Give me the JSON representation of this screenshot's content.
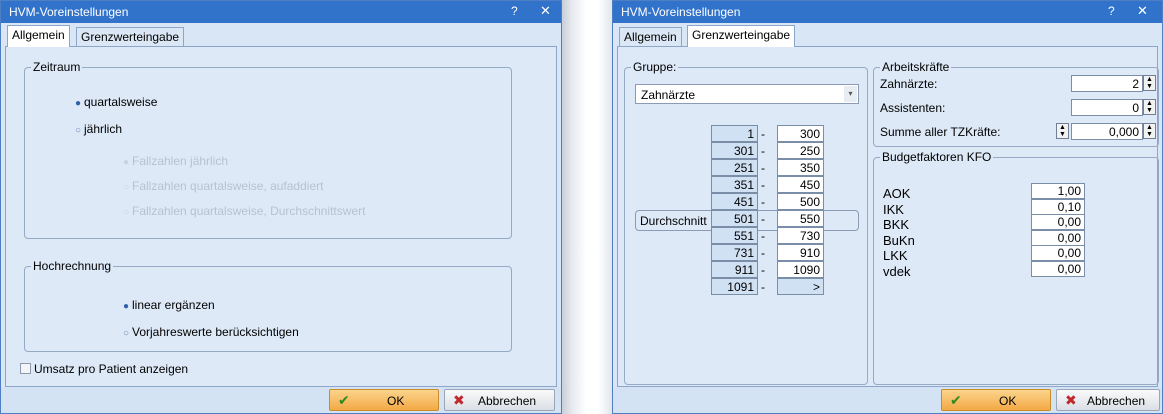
{
  "left": {
    "title": "HVM-Voreinstellungen",
    "help": "?",
    "close": "✕",
    "tabs": [
      "Allgemein",
      "Grenzwerteingabe"
    ],
    "zeitraum": {
      "title": "Zeitraum",
      "options": [
        "quartalsweise",
        "jährlich"
      ],
      "sub_options": [
        "Fallzahlen jährlich",
        "Fallzahlen quartalsweise, aufaddiert",
        "Fallzahlen quartalsweise, Durchschnittswert"
      ]
    },
    "hochrechnung": {
      "title": "Hochrechnung",
      "options": [
        "linear ergänzen",
        "Vorjahreswerte berücksichtigen"
      ]
    },
    "umsatz_checkbox": "Umsatz pro Patient anzeigen",
    "buttons": {
      "ok": "OK",
      "cancel": "Abbrechen"
    }
  },
  "right": {
    "title": "HVM-Voreinstellungen",
    "help": "?",
    "close": "✕",
    "tabs": [
      "Allgemein",
      "Grenzwerteingabe"
    ],
    "gruppe": {
      "title": "Gruppe:",
      "selected": "Zahnärzte",
      "durchschnitt": "Durchschnitt",
      "ranges": [
        {
          "from": "1",
          "to": "300"
        },
        {
          "from": "301",
          "to": "250"
        },
        {
          "from": "251",
          "to": "350"
        },
        {
          "from": "351",
          "to": "450"
        },
        {
          "from": "451",
          "to": "500"
        },
        {
          "from": "501",
          "to": "550"
        },
        {
          "from": "551",
          "to": "730"
        },
        {
          "from": "731",
          "to": "910"
        },
        {
          "from": "911",
          "to": "1090"
        },
        {
          "from": "1091",
          "to": ">"
        }
      ],
      "dash": "-"
    },
    "arbeitskraefte": {
      "title": "Arbeitskräfte",
      "zahnaerzte_label": "Zahnärzte:",
      "zahnaerzte_value": "2",
      "assistenten_label": "Assistenten:",
      "assistenten_value": "0",
      "summe_label": "Summe aller TZKräfte:",
      "summe_value": "0,000"
    },
    "budget": {
      "title": "Budgetfaktoren KFO",
      "rows": [
        {
          "label": "AOK",
          "value": "1,00"
        },
        {
          "label": "IKK",
          "value": "0,10"
        },
        {
          "label": "BKK",
          "value": "0,00"
        },
        {
          "label": "BuKn",
          "value": "0,00"
        },
        {
          "label": "LKK",
          "value": "0,00"
        },
        {
          "label": "vdek",
          "value": "0,00"
        }
      ]
    },
    "buttons": {
      "ok": "OK",
      "cancel": "Abbrechen"
    }
  },
  "colors": {
    "titlebar": "#3173cb",
    "panel": "#dde9f7",
    "ok_button": "#f3a945",
    "check_icon": "#2e8b1e",
    "cancel_icon": "#c0282c"
  },
  "icons": [
    "check-icon",
    "cross-icon",
    "dropdown-arrow-icon",
    "spin-up-icon",
    "spin-down-icon"
  ]
}
